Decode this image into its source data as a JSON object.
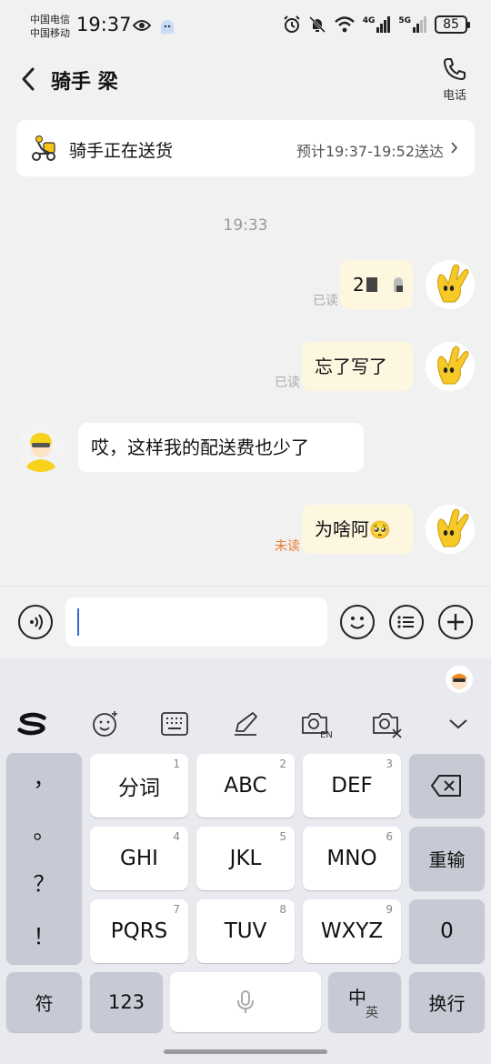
{
  "status_bar": {
    "carrier1": "中国电信",
    "carrier2": "中国移动",
    "time": "19:37",
    "sig1_label": "4G",
    "sig2_label": "5G",
    "battery": "85"
  },
  "header": {
    "title": "骑手 梁",
    "call_label": "电话"
  },
  "delivery": {
    "status": "骑手正在送货",
    "eta": "预计19:37-19:52送达"
  },
  "chat": {
    "timestamp": "19:33",
    "messages": [
      {
        "from": "me",
        "text": "2",
        "status": "已读"
      },
      {
        "from": "me",
        "text": "忘了写了",
        "status": "已读"
      },
      {
        "from": "rider",
        "text": "哎，这样我的配送费也少了"
      },
      {
        "from": "me",
        "text": "为啥阿",
        "emoji": "🥺",
        "status": "未读"
      }
    ]
  },
  "input": {
    "value": "",
    "placeholder": ""
  },
  "keyboard": {
    "punct": [
      "，",
      "。",
      "？",
      "！"
    ],
    "rows": [
      [
        {
          "label": "分词",
          "num": "1"
        },
        {
          "label": "ABC",
          "num": "2"
        },
        {
          "label": "DEF",
          "num": "3"
        }
      ],
      [
        {
          "label": "GHI",
          "num": "4"
        },
        {
          "label": "JKL",
          "num": "5"
        },
        {
          "label": "MNO",
          "num": "6"
        }
      ],
      [
        {
          "label": "PQRS",
          "num": "7"
        },
        {
          "label": "TUV",
          "num": "8"
        },
        {
          "label": "WXYZ",
          "num": "9"
        }
      ]
    ],
    "reinput": "重输",
    "zero": "0",
    "symbols": "符",
    "num_mode": "123",
    "lang_main": "中",
    "lang_alt": "英",
    "enter": "换行"
  },
  "colors": {
    "my_bubble": "#fdf7df",
    "their_bubble": "#ffffff",
    "unread": "#ee7a2c",
    "caret": "#2f66d8"
  }
}
